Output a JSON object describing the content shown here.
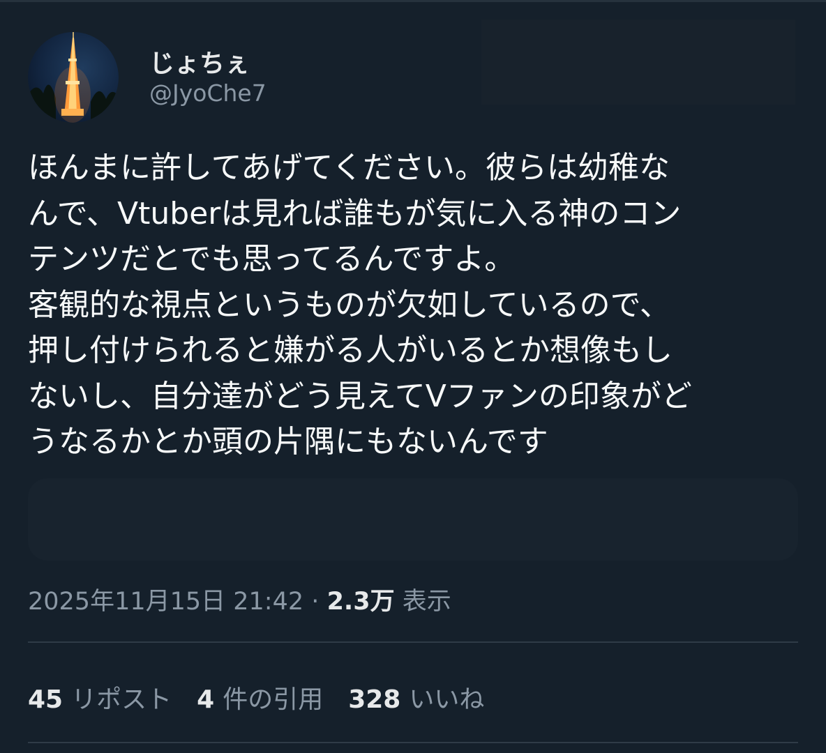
{
  "user": {
    "display_name": "じょちぇ",
    "handle": "@JyoChe7",
    "avatar": "tokyo-tower-night-photo"
  },
  "tweet": {
    "lines": [
      "ほんまに許してあげてください。彼らは幼稚な",
      "んで、Vtuberは見れば誰もが気に入る神のコン",
      "テンツだとでも思ってるんですよ。",
      "客観的な視点というものが欠如しているので、",
      "押し付けられると嫌がる人がいるとか想像もし",
      "ないし、自分達がどう見えてVファンの印象がど",
      "うなるかとか頭の片隅にもないんです"
    ]
  },
  "meta": {
    "timestamp": "2025年11月15日 21:42",
    "separator": "·",
    "views_count": "2.3万",
    "views_label": "表示"
  },
  "stats": {
    "reposts_count": "45",
    "reposts_label": "リポスト",
    "quotes_count": "4",
    "quotes_label": "件の引用",
    "likes_count": "328",
    "likes_label": "いいね"
  },
  "colors": {
    "background": "#15202b",
    "text_primary": "#e7e9ea",
    "text_secondary": "#8b98a5",
    "divider": "#2f3b47"
  }
}
